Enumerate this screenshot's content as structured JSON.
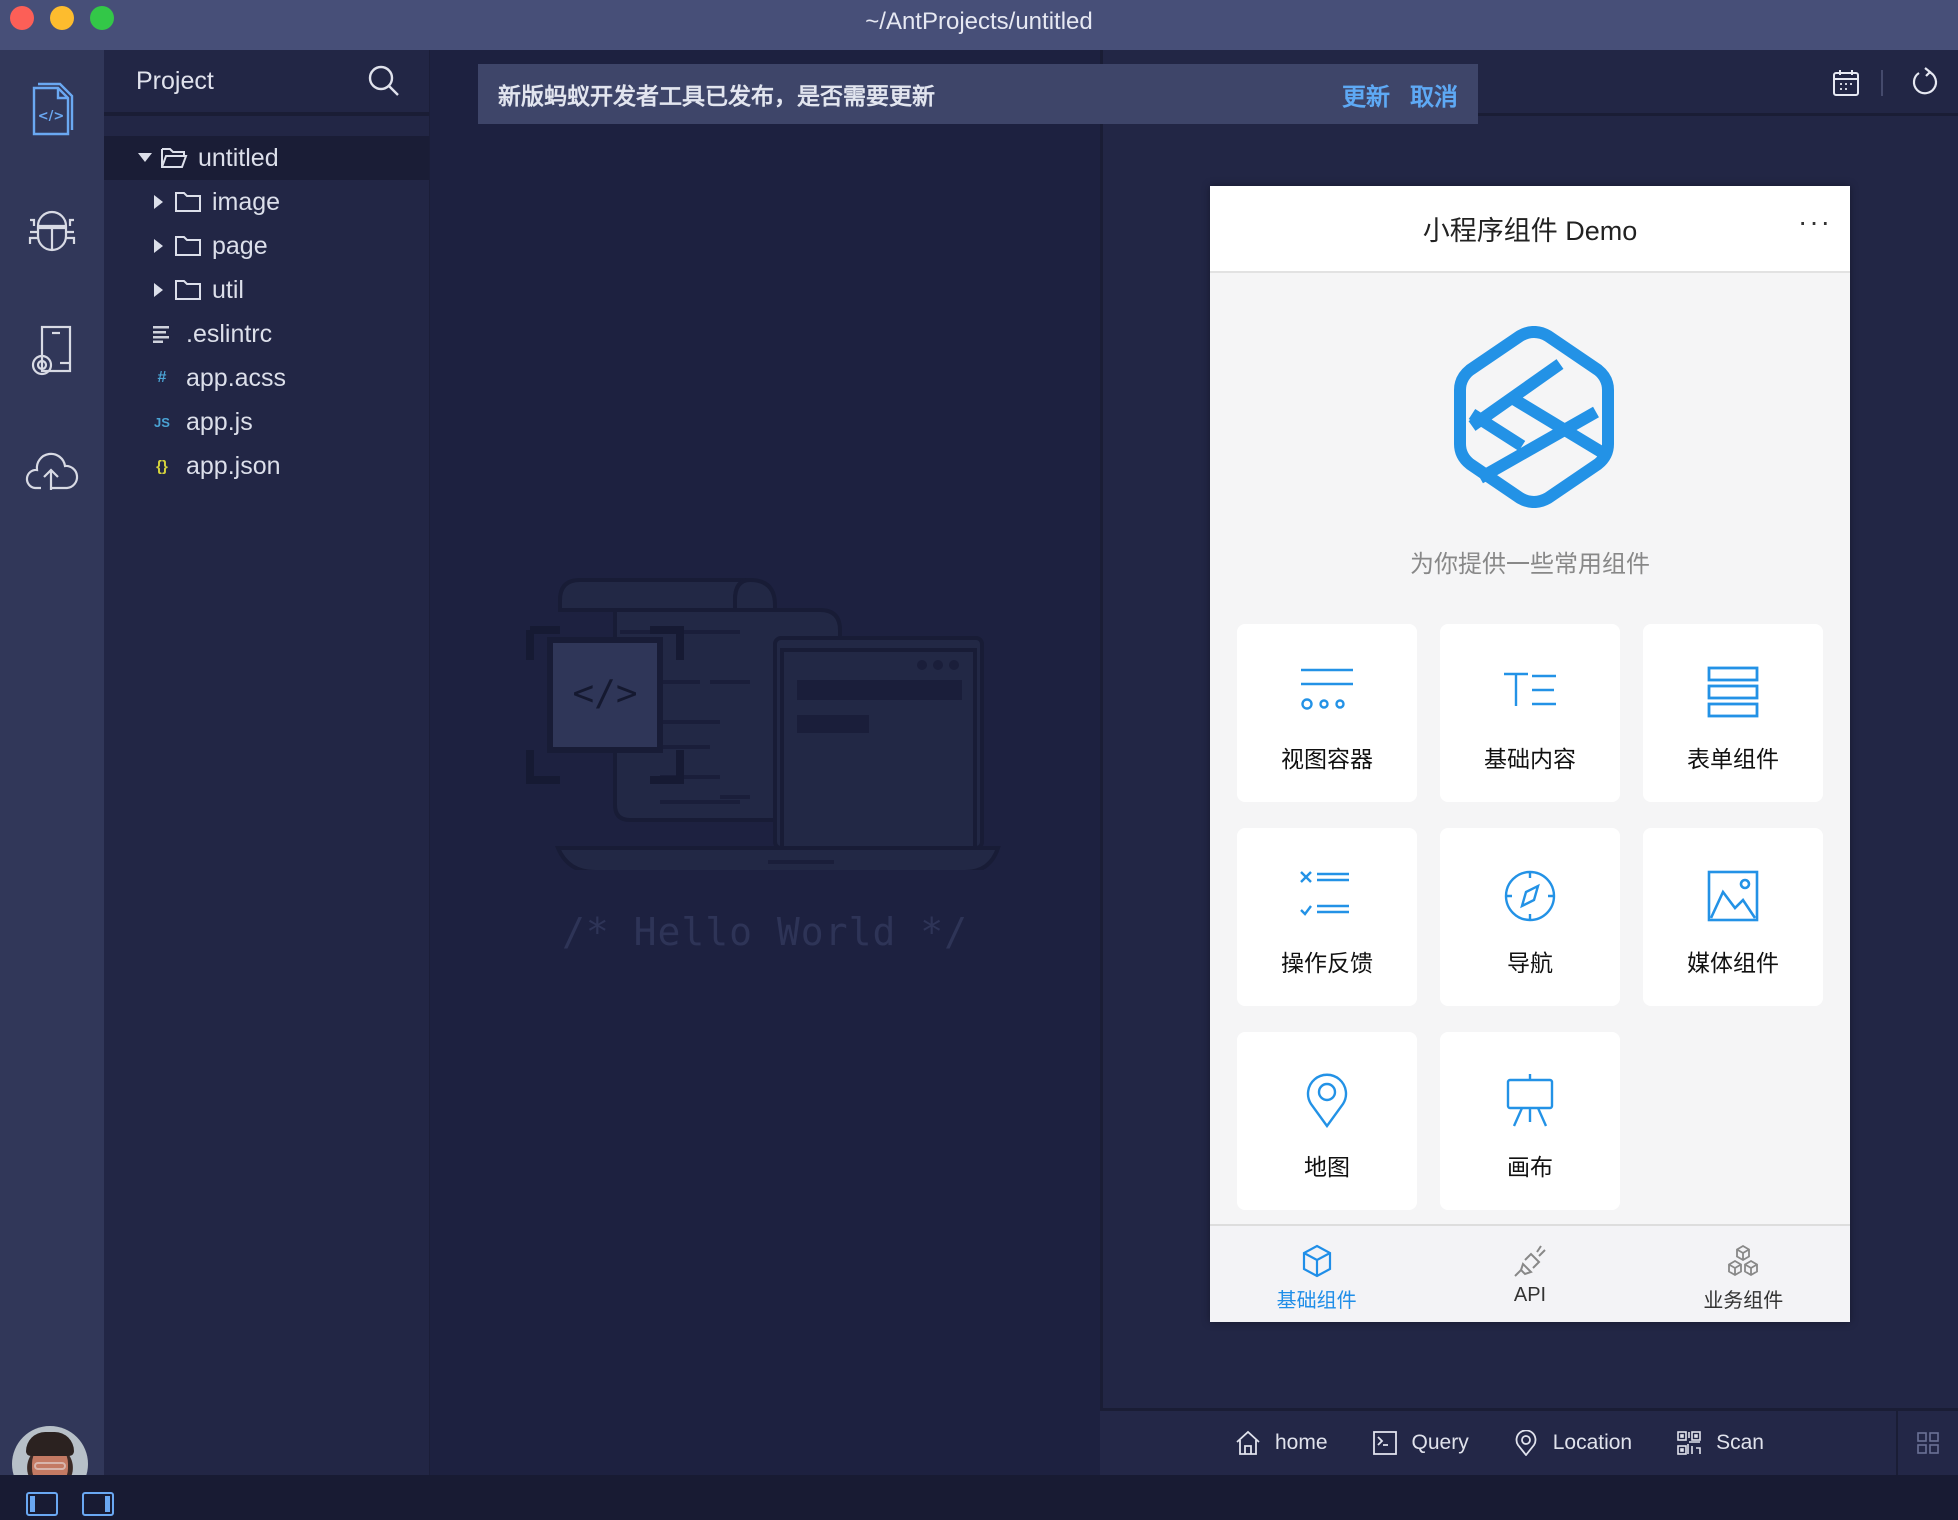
{
  "window": {
    "title": "~/AntProjects/untitled"
  },
  "activity_bar": {
    "items": [
      {
        "name": "explorer-icon",
        "active": true
      },
      {
        "name": "debug-bug-icon",
        "active": false
      },
      {
        "name": "device-settings-icon",
        "active": false
      },
      {
        "name": "cloud-upload-icon",
        "active": false
      }
    ],
    "avatar_alt": "user avatar"
  },
  "sidebar": {
    "title": "Project",
    "tree": [
      {
        "label": "untitled",
        "type": "folder",
        "expanded": true,
        "depth": 0,
        "selected": true
      },
      {
        "label": "image",
        "type": "folder",
        "expanded": false,
        "depth": 1
      },
      {
        "label": "page",
        "type": "folder",
        "expanded": false,
        "depth": 1
      },
      {
        "label": "util",
        "type": "folder",
        "expanded": false,
        "depth": 1
      },
      {
        "label": ".eslintrc",
        "type": "text",
        "badge": "≡",
        "badge_color": "#cfd2dc",
        "depth": 1
      },
      {
        "label": "app.acss",
        "type": "css",
        "badge": "#",
        "badge_color": "#4aa3d4",
        "depth": 1
      },
      {
        "label": "app.js",
        "type": "js",
        "badge": "JS",
        "badge_color": "#4aa3d4",
        "depth": 1
      },
      {
        "label": "app.json",
        "type": "json",
        "badge": "{}",
        "badge_color": "#d6d43c",
        "depth": 1
      }
    ]
  },
  "notification": {
    "message": "新版蚂蚁开发者工具已发布，是否需要更新",
    "update_label": "更新",
    "cancel_label": "取消"
  },
  "editor": {
    "placeholder_text": "/* Hello World */"
  },
  "simulator": {
    "nav_title": "小程序组件 Demo",
    "more_label": "···",
    "subtitle": "为你提供一些常用组件",
    "accent_color": "#1f8ee8",
    "cards": [
      {
        "label": "视图容器",
        "icon": "view-container-icon"
      },
      {
        "label": "基础内容",
        "icon": "basic-content-icon"
      },
      {
        "label": "表单组件",
        "icon": "form-icon"
      },
      {
        "label": "操作反馈",
        "icon": "feedback-icon"
      },
      {
        "label": "导航",
        "icon": "compass-icon"
      },
      {
        "label": "媒体组件",
        "icon": "image-icon"
      },
      {
        "label": "地图",
        "icon": "map-pin-icon"
      },
      {
        "label": "画布",
        "icon": "easel-icon"
      }
    ],
    "tabs": [
      {
        "label": "基础组件",
        "icon": "cube-icon",
        "active": true
      },
      {
        "label": "API",
        "icon": "plug-icon",
        "active": false
      },
      {
        "label": "业务组件",
        "icon": "cubes-icon",
        "active": false
      }
    ]
  },
  "sim_toolbar": {
    "tools": [
      {
        "label": "home",
        "icon": "home-icon"
      },
      {
        "label": "Query",
        "icon": "terminal-icon"
      },
      {
        "label": "Location",
        "icon": "location-icon"
      },
      {
        "label": "Scan",
        "icon": "qr-scan-icon"
      }
    ]
  }
}
